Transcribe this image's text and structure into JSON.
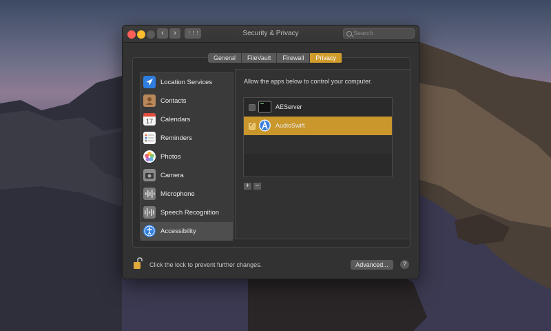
{
  "window": {
    "title": "Security & Privacy",
    "search_placeholder": "Search",
    "nav_back": "‹",
    "nav_forward": "›",
    "grid_glyph": "⋮⋮⋮"
  },
  "tabs": [
    {
      "label": "General"
    },
    {
      "label": "FileVault"
    },
    {
      "label": "Firewall"
    },
    {
      "label": "Privacy",
      "active": true
    }
  ],
  "sidebar": {
    "items": [
      {
        "label": "Location Services",
        "icon": "location-arrow-icon"
      },
      {
        "label": "Contacts",
        "icon": "contacts-icon"
      },
      {
        "label": "Calendars",
        "icon": "calendar-icon",
        "day": "17"
      },
      {
        "label": "Reminders",
        "icon": "reminders-icon"
      },
      {
        "label": "Photos",
        "icon": "photos-icon"
      },
      {
        "label": "Camera",
        "icon": "camera-icon"
      },
      {
        "label": "Microphone",
        "icon": "microphone-icon"
      },
      {
        "label": "Speech Recognition",
        "icon": "speech-recognition-icon"
      },
      {
        "label": "Accessibility",
        "icon": "accessibility-icon",
        "selected": true
      }
    ]
  },
  "main": {
    "prompt": "Allow the apps below to control your computer.",
    "apps": [
      {
        "name": "AEServer",
        "checked": false,
        "icon": "terminal-icon"
      },
      {
        "name": "AudioSwift",
        "checked": true,
        "selected": true,
        "icon": "audioswift-icon"
      }
    ],
    "add_label": "+",
    "remove_label": "−"
  },
  "footer": {
    "lock_text": "Click the lock to prevent further changes.",
    "advanced_label": "Advanced...",
    "help_label": "?"
  },
  "colors": {
    "accent": "#d09c2c",
    "selection": "#c9972b"
  }
}
